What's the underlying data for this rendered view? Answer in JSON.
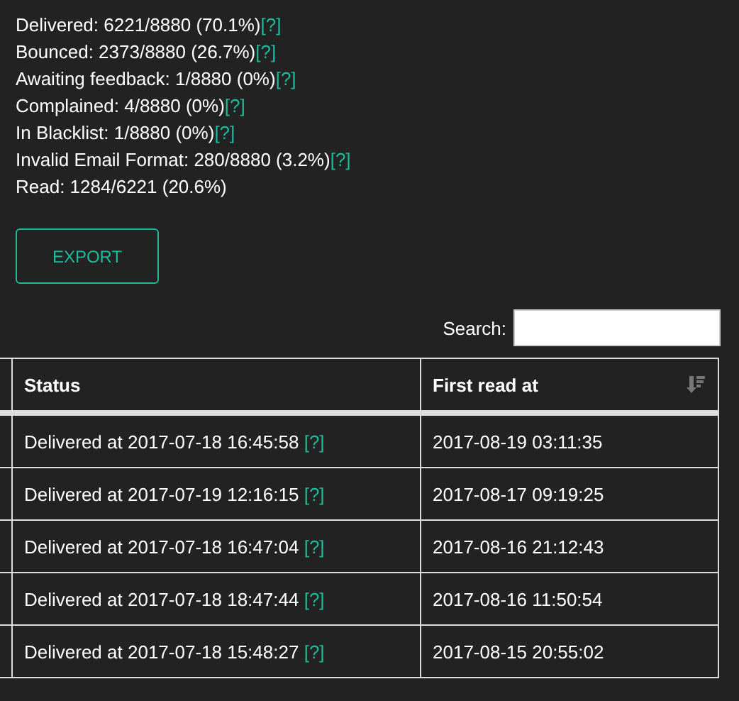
{
  "stats": [
    {
      "text": "Delivered: 6221/8880 (70.1%)",
      "help": "[?]"
    },
    {
      "text": "Bounced: 2373/8880 (26.7%)",
      "help": "[?]"
    },
    {
      "text": "Awaiting feedback: 1/8880 (0%)",
      "help": "[?]"
    },
    {
      "text": "Complained: 4/8880 (0%)",
      "help": "[?]"
    },
    {
      "text": "In Blacklist: 1/8880 (0%)",
      "help": "[?]"
    },
    {
      "text": "Invalid Email Format: 280/8880 (3.2%)",
      "help": "[?]"
    },
    {
      "text": "Read: 1284/6221 (20.6%)"
    }
  ],
  "export_button": "EXPORT",
  "search": {
    "label": "Search:"
  },
  "table": {
    "columns": [
      "Status",
      "First read at"
    ],
    "rows": [
      {
        "status": "Delivered at 2017-07-18 16:45:58",
        "help": "[?]",
        "first_read": "2017-08-19 03:11:35"
      },
      {
        "status": "Delivered at 2017-07-19 12:16:15",
        "help": "[?]",
        "first_read": "2017-08-17 09:19:25"
      },
      {
        "status": "Delivered at 2017-07-18 16:47:04",
        "help": "[?]",
        "first_read": "2017-08-16 21:12:43"
      },
      {
        "status": "Delivered at 2017-07-18 18:47:44",
        "help": "[?]",
        "first_read": "2017-08-16 11:50:54"
      },
      {
        "status": "Delivered at 2017-07-18 15:48:27",
        "help": "[?]",
        "first_read": "2017-08-15 20:55:02"
      }
    ]
  }
}
